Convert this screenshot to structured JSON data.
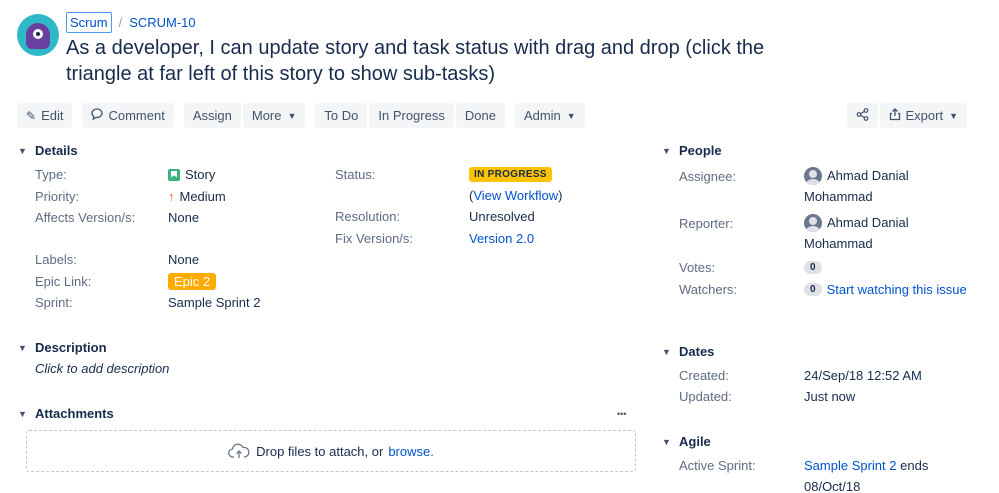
{
  "breadcrumb": {
    "project": "Scrum",
    "separator": "/",
    "issue_key": "SCRUM-10"
  },
  "issue_title": "As a developer, I can update story and task status with drag and drop (click the triangle at far left of this story to show sub-tasks)",
  "toolbar": {
    "edit": "Edit",
    "comment": "Comment",
    "assign": "Assign",
    "more": "More",
    "todo": "To Do",
    "in_progress": "In Progress",
    "done": "Done",
    "admin": "Admin",
    "export": "Export"
  },
  "details": {
    "heading": "Details",
    "type_label": "Type:",
    "type_value": "Story",
    "priority_label": "Priority:",
    "priority_value": "Medium",
    "affects_label": "Affects Version/s:",
    "affects_value": "None",
    "labels_label": "Labels:",
    "labels_value": "None",
    "epic_label": "Epic Link:",
    "epic_value": "Epic 2",
    "sprint_label": "Sprint:",
    "sprint_value": "Sample Sprint 2",
    "status_label": "Status:",
    "status_value": "IN PROGRESS",
    "view_workflow_open": "(",
    "view_workflow": "View Workflow",
    "view_workflow_close": ")",
    "resolution_label": "Resolution:",
    "resolution_value": "Unresolved",
    "fix_label": "Fix Version/s:",
    "fix_value": "Version 2.0"
  },
  "description": {
    "heading": "Description",
    "placeholder": "Click to add description"
  },
  "attachments": {
    "heading": "Attachments",
    "more": "•••",
    "drop_text": "Drop files to attach, or",
    "browse": "browse."
  },
  "people": {
    "heading": "People",
    "assignee_label": "Assignee:",
    "assignee_first": "Ahmad Danial",
    "assignee_last": "Mohammad",
    "reporter_label": "Reporter:",
    "reporter_first": "Ahmad Danial",
    "reporter_last": "Mohammad",
    "votes_label": "Votes:",
    "votes_count": "0",
    "watchers_label": "Watchers:",
    "watchers_count": "0",
    "watch_link": "Start watching this issue"
  },
  "dates": {
    "heading": "Dates",
    "created_label": "Created:",
    "created_value": "24/Sep/18 12:52 AM",
    "updated_label": "Updated:",
    "updated_value": "Just now"
  },
  "agile": {
    "heading": "Agile",
    "active_sprint_label": "Active Sprint:",
    "active_sprint_link": "Sample Sprint 2",
    "ends_text": "ends",
    "end_date": "08/Oct/18"
  },
  "icons": {
    "edit": "pencil-icon",
    "comment": "speech-bubble-icon",
    "share": "share-icon",
    "export": "export-icon",
    "collapse": "triangle-down-icon",
    "upload": "cloud-upload-icon"
  },
  "colors": {
    "link": "#0052cc",
    "status_lozenge": "#ffc400",
    "epic": "#ffab00",
    "story": "#36b37e",
    "priority_medium": "#ff5630"
  }
}
